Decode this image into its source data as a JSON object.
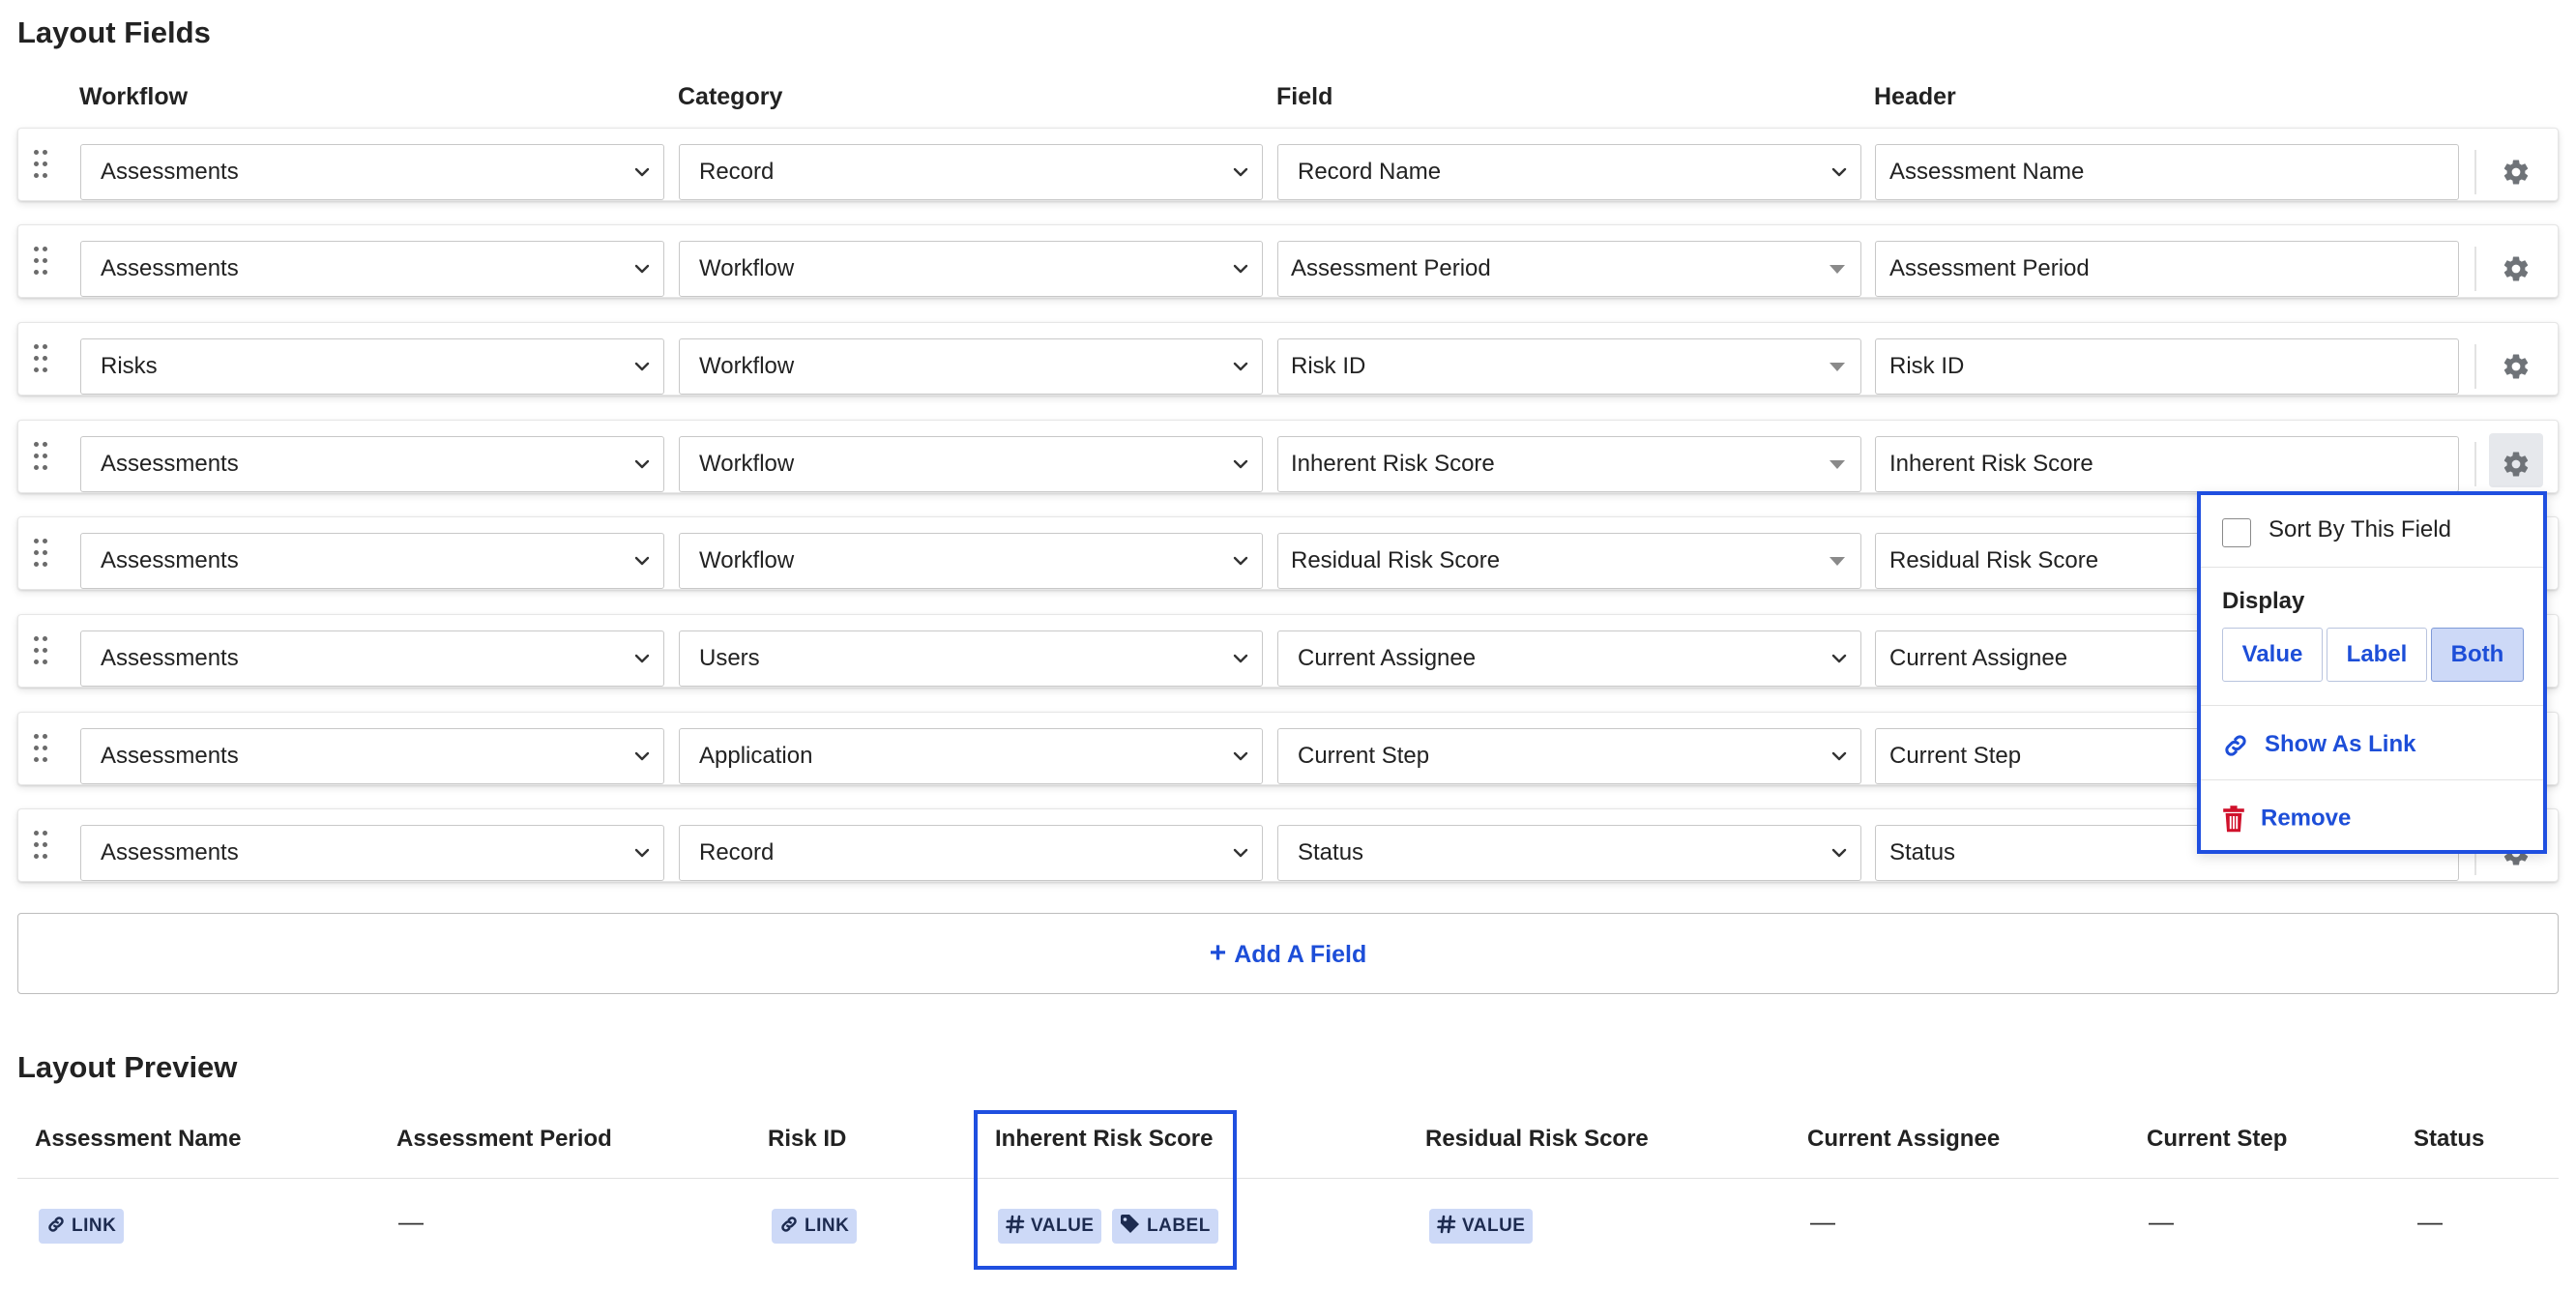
{
  "sections": {
    "layout_fields": "Layout Fields",
    "layout_preview": "Layout Preview"
  },
  "columns": {
    "workflow": "Workflow",
    "category": "Category",
    "field": "Field",
    "header": "Header"
  },
  "rows": [
    {
      "workflow": "Assessments",
      "category": "Record",
      "field": "Record Name",
      "field_style": "chevron",
      "header": "Assessment Name"
    },
    {
      "workflow": "Assessments",
      "category": "Workflow",
      "field": "Assessment Period",
      "field_style": "triangle",
      "header": "Assessment Period"
    },
    {
      "workflow": "Risks",
      "category": "Workflow",
      "field": "Risk ID",
      "field_style": "triangle",
      "header": "Risk ID"
    },
    {
      "workflow": "Assessments",
      "category": "Workflow",
      "field": "Inherent Risk Score",
      "field_style": "triangle",
      "header": "Inherent Risk Score"
    },
    {
      "workflow": "Assessments",
      "category": "Workflow",
      "field": "Residual Risk Score",
      "field_style": "triangle",
      "header": "Residual Risk Score"
    },
    {
      "workflow": "Assessments",
      "category": "Users",
      "field": "Current Assignee",
      "field_style": "chevron",
      "header": "Current Assignee"
    },
    {
      "workflow": "Assessments",
      "category": "Application",
      "field": "Current Step",
      "field_style": "chevron",
      "header": "Current Step"
    },
    {
      "workflow": "Assessments",
      "category": "Record",
      "field": "Status",
      "field_style": "chevron",
      "header": "Status"
    }
  ],
  "add_field_label": "Add A Field",
  "popup": {
    "sort_label": "Sort By This Field",
    "sort_checked": false,
    "display_label": "Display",
    "display_options": [
      "Value",
      "Label",
      "Both"
    ],
    "display_selected": "Both",
    "show_as_link": "Show As Link",
    "remove": "Remove"
  },
  "preview": {
    "headers": [
      "Assessment Name",
      "Assessment Period",
      "Risk ID",
      "Inherent Risk Score",
      "Residual Risk Score",
      "Current Assignee",
      "Current Step",
      "Status"
    ],
    "chips": {
      "link": "LINK",
      "value": "VALUE",
      "label": "LABEL"
    },
    "dash": "—"
  },
  "colors": {
    "accent": "#1d4ed8",
    "highlight_border": "#1f4fe0",
    "chip_bg": "#cdd9f7",
    "remove_red": "#d0112b"
  }
}
